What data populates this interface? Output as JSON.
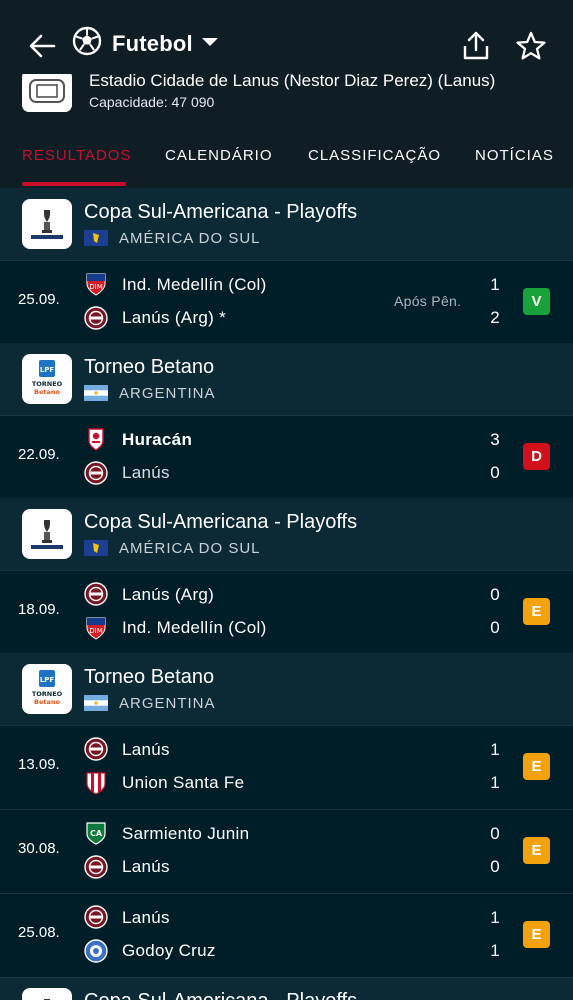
{
  "header": {
    "sport_title": "Futebol",
    "icons": [
      "back-arrow-icon",
      "soccer-ball-icon",
      "caret-down-icon",
      "share-icon",
      "star-icon"
    ]
  },
  "stadium": {
    "name": "Estadio Cidade de Lanus (Nestor Diaz Perez) (Lanus)",
    "capacity": "Capacidade: 47 090"
  },
  "tabs": [
    {
      "label": "RESULTADOS",
      "active": true
    },
    {
      "label": "CALENDÁRIO",
      "active": false
    },
    {
      "label": "CLASSIFICAÇÃO",
      "active": false
    },
    {
      "label": "NOTÍCIAS",
      "active": false
    }
  ],
  "colors": {
    "accent": "#c8102e",
    "background": "#001e28",
    "section_bg": "#0b2a35",
    "win": "#1aa23a",
    "loss": "#d0101b",
    "draw": "#f2a20c"
  },
  "sections": [
    {
      "league": "Copa Sul-Americana - Playoffs",
      "country": "AMÉRICA DO SUL"
    },
    {
      "league": "Torneo Betano",
      "country": "ARGENTINA"
    },
    {
      "league": "Copa Sul-Americana - Playoffs",
      "country": "AMÉRICA DO SUL"
    },
    {
      "league": "Torneo Betano",
      "country": "ARGENTINA"
    },
    {
      "league": "Copa Sul-Americana - Playoffs",
      "country": ""
    }
  ],
  "matches": [
    {
      "date": "25.09.",
      "home": "Ind. Medellín (Col)",
      "away": "Lanús (Arg) *",
      "home_score": "1",
      "away_score": "2",
      "note": "Após Pên.",
      "result": "V"
    },
    {
      "date": "22.09.",
      "home": "Huracán",
      "away": "Lanús",
      "home_score": "3",
      "away_score": "0",
      "note": "",
      "result": "D"
    },
    {
      "date": "18.09.",
      "home": "Lanús (Arg)",
      "away": "Ind. Medellín (Col)",
      "home_score": "0",
      "away_score": "0",
      "note": "",
      "result": "E"
    },
    {
      "date": "13.09.",
      "home": "Lanús",
      "away": "Union Santa Fe",
      "home_score": "1",
      "away_score": "1",
      "note": "",
      "result": "E"
    },
    {
      "date": "30.08.",
      "home": "Sarmiento Junin",
      "away": "Lanús",
      "home_score": "0",
      "away_score": "0",
      "note": "",
      "result": "E"
    },
    {
      "date": "25.08.",
      "home": "Lanús",
      "away": "Godoy Cruz",
      "home_score": "1",
      "away_score": "1",
      "note": "",
      "result": "E"
    }
  ]
}
